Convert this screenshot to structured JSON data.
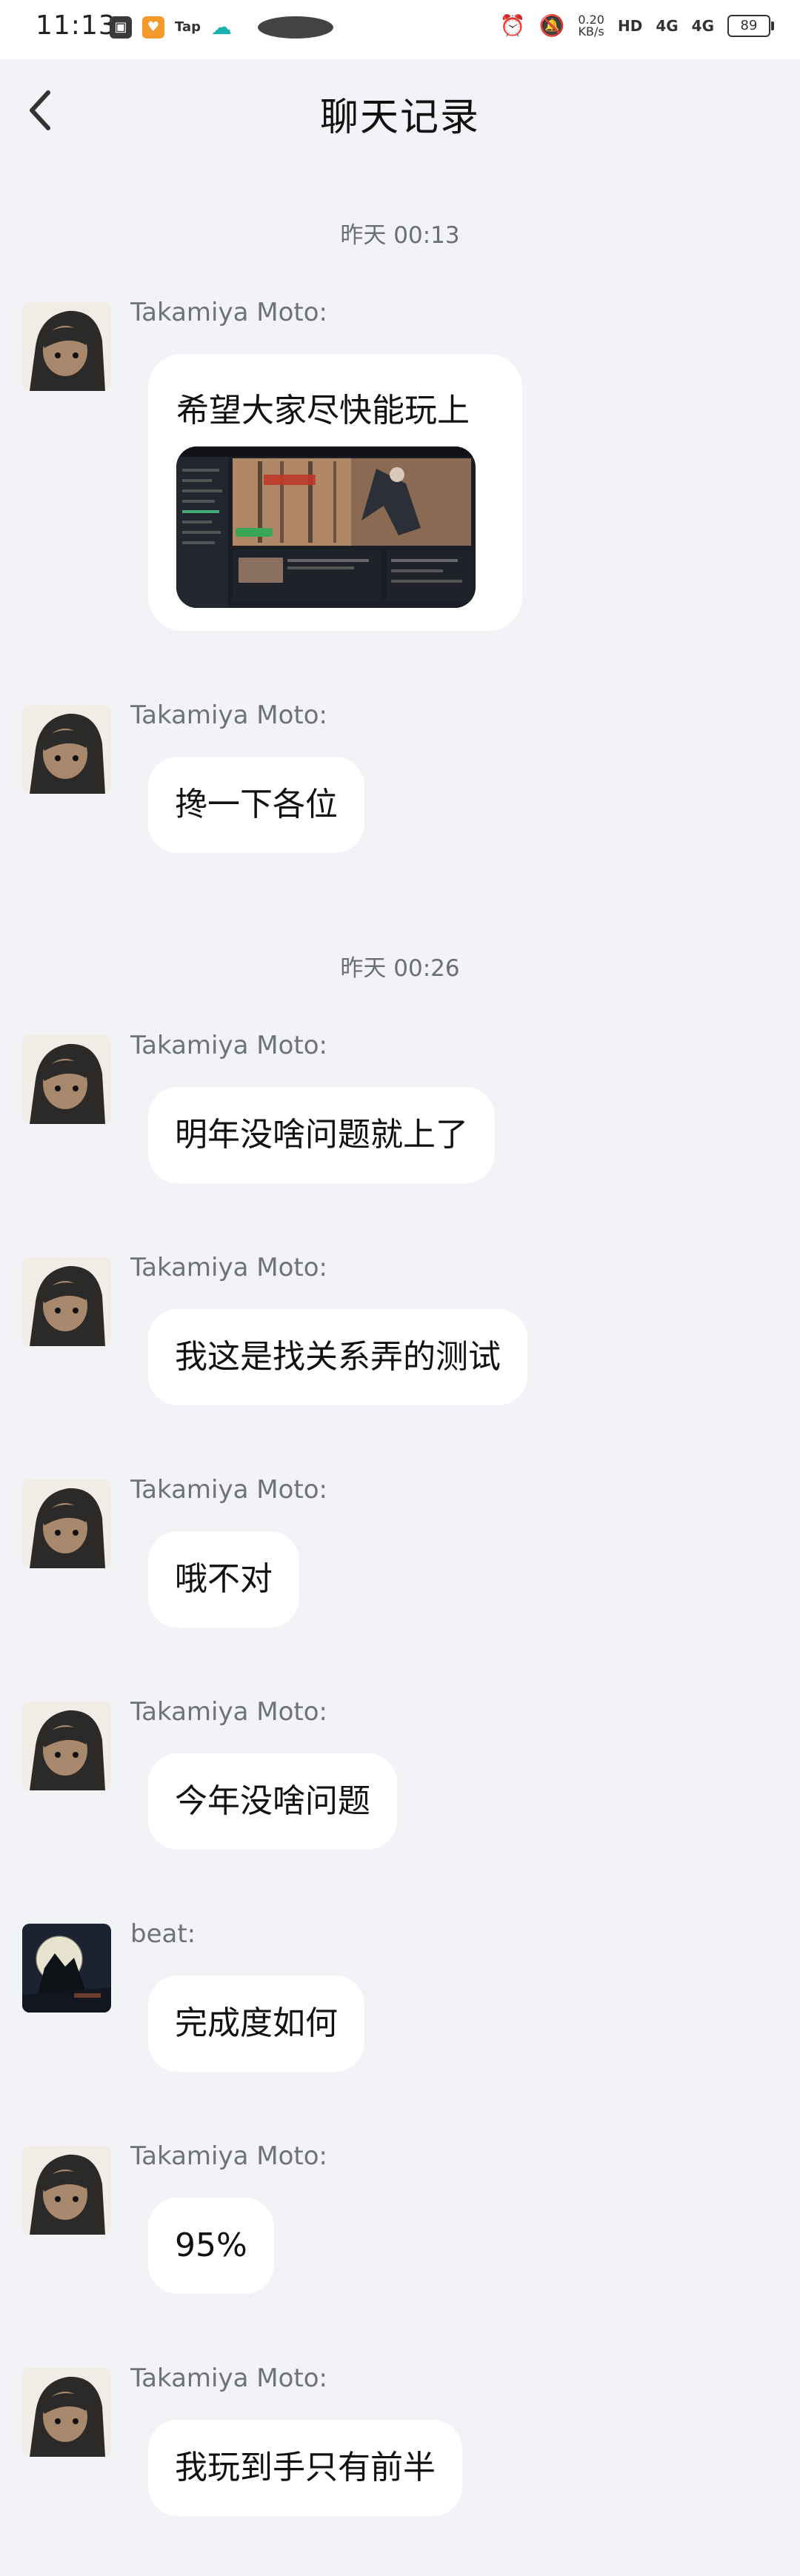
{
  "status_bar": {
    "time": "11:13",
    "tap_label": "Tap",
    "net_speed": "0.20",
    "net_unit": "KB/s",
    "hd_label": "HD",
    "sim1": "4G",
    "sim2": "4G",
    "battery": "89"
  },
  "header": {
    "title": "聊天记录"
  },
  "timestamps": [
    "昨天 00:13",
    "昨天 00:26"
  ],
  "messages": [
    {
      "sender": "Takamiya Moto:",
      "text": "希望大家尽快能玩上",
      "has_image": true
    },
    {
      "sender": "Takamiya Moto:",
      "text": "搀一下各位"
    },
    {
      "sender": "Takamiya Moto:",
      "text": "明年没啥问题就上了"
    },
    {
      "sender": "Takamiya Moto:",
      "text": "我这是找关系弄的测试"
    },
    {
      "sender": "Takamiya Moto:",
      "text": "哦不对"
    },
    {
      "sender": "Takamiya Moto:",
      "text": "今年没啥问题"
    },
    {
      "sender": "beat:",
      "text": "完成度如何"
    },
    {
      "sender": "Takamiya Moto:",
      "text": "95%"
    },
    {
      "sender": "Takamiya Moto:",
      "text": "我玩到手只有前半"
    }
  ],
  "colors": {
    "background": "#f2f3f7",
    "bubble": "#ffffff",
    "sender_text": "#6f7279",
    "timestamp_text": "#6b6e76"
  }
}
